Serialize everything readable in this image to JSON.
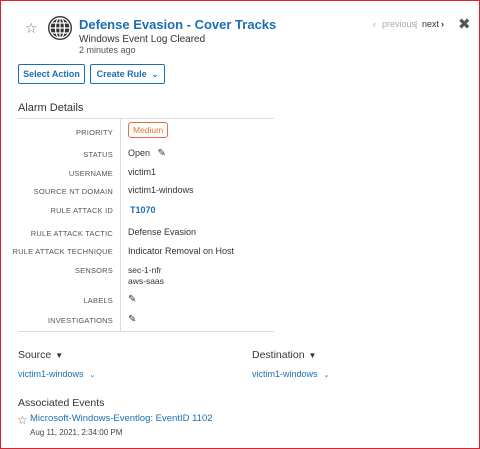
{
  "header": {
    "title": "Defense Evasion - Cover Tracks",
    "subtitle": "Windows Event Log Cleared",
    "time_ago": "2 minutes ago",
    "previous_label": "previous",
    "separator": "|",
    "next_label": "next"
  },
  "actions": {
    "select_action": "Select Action",
    "create_rule": "Create Rule"
  },
  "alarm_details": {
    "section_title": "Alarm Details",
    "priority": {
      "label": "PRIORITY",
      "value": "Medium"
    },
    "status": {
      "label": "STATUS",
      "value": "Open"
    },
    "username": {
      "label": "USERNAME",
      "value": "victim1"
    },
    "source_nt_domain": {
      "label": "SOURCE NT DOMAIN",
      "value": "victim1-windows"
    },
    "rule_attack_id": {
      "label": "RULE ATTACK ID",
      "value": "T1070"
    },
    "rule_attack_tactic": {
      "label": "RULE ATTACK TACTIC",
      "value": "Defense Evasion"
    },
    "rule_attack_technique": {
      "label": "RULE ATTACK TECHNIQUE",
      "value": "Indicator Removal on Host"
    },
    "sensors": {
      "label": "SENSORS",
      "values": [
        "sec-1-nfr",
        "aws-saas"
      ]
    },
    "labels": {
      "label": "LABELS"
    },
    "investigations": {
      "label": "INVESTIGATIONS"
    }
  },
  "source": {
    "title": "Source",
    "value": "victim1-windows"
  },
  "destination": {
    "title": "Destination",
    "value": "victim1-windows"
  },
  "associated_events": {
    "title": "Associated Events",
    "items": [
      {
        "name": "Microsoft-Windows-Eventlog: EventID 1102",
        "timestamp": "Aug 11, 2021, 2:34:00 PM"
      }
    ]
  },
  "colors": {
    "accent": "#1a6fb4",
    "priority_medium": "#e0703b",
    "frame_border": "#d9242b"
  },
  "icons": [
    "star-icon",
    "globe-icon",
    "chevron-left-icon",
    "chevron-right-icon",
    "close-icon",
    "chevron-down-icon",
    "pencil-icon"
  ]
}
